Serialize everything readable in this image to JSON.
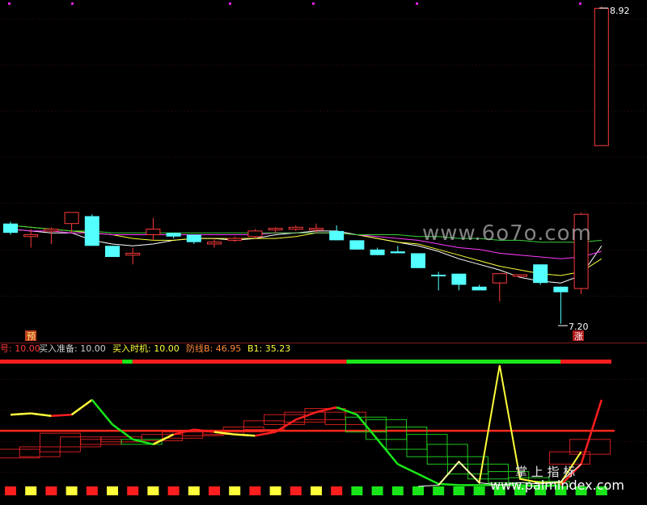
{
  "main_chart": {
    "high_label": "8.92",
    "low_label": "7.20",
    "marker_yu": "预",
    "marker_zhang": "涨"
  },
  "indicator_header": {
    "item0": "号: 10.00",
    "item1": "买入准备: 10.00",
    "item2": "买入时机: 10.00",
    "item3": "防线B: 46.95",
    "item4": "B1: 35.23"
  },
  "watermarks": {
    "top": "www.6o7o.com",
    "bottom_cn": "掌 上 指 标",
    "bottom_url": "www.palmindex.com"
  },
  "colors": {
    "up": "#ff3b3b",
    "down": "#54ffff",
    "ma_white": "#ffffff",
    "ma_yellow": "#ffff3a",
    "ma_magenta": "#ff3cff",
    "ma_green": "#3cd23c",
    "ind_red": "#ff1e1e",
    "ind_green": "#19e619"
  },
  "chart_data": [
    {
      "type": "candlestick",
      "title": "",
      "price_labels": {
        "high": 8.92,
        "low": 7.2
      },
      "candles": [
        {
          "o": 7.75,
          "h": 7.76,
          "l": 7.69,
          "c": 7.7,
          "up": false
        },
        {
          "o": 7.68,
          "h": 7.72,
          "l": 7.62,
          "c": 7.69,
          "up": true
        },
        {
          "o": 7.72,
          "h": 7.73,
          "l": 7.64,
          "c": 7.71,
          "up": true
        },
        {
          "o": 7.75,
          "h": 7.81,
          "l": 7.7,
          "c": 7.81,
          "up": true
        },
        {
          "o": 7.79,
          "h": 7.8,
          "l": 7.63,
          "c": 7.63,
          "up": false
        },
        {
          "o": 7.63,
          "h": 7.63,
          "l": 7.57,
          "c": 7.57,
          "up": false
        },
        {
          "o": 7.59,
          "h": 7.62,
          "l": 7.53,
          "c": 7.58,
          "up": true
        },
        {
          "o": 7.69,
          "h": 7.78,
          "l": 7.66,
          "c": 7.72,
          "up": true
        },
        {
          "o": 7.7,
          "h": 7.7,
          "l": 7.67,
          "c": 7.68,
          "up": false
        },
        {
          "o": 7.69,
          "h": 7.69,
          "l": 7.64,
          "c": 7.65,
          "up": false
        },
        {
          "o": 7.65,
          "h": 7.67,
          "l": 7.62,
          "c": 7.64,
          "up": true
        },
        {
          "o": 7.66,
          "h": 7.68,
          "l": 7.65,
          "c": 7.67,
          "up": true
        },
        {
          "o": 7.68,
          "h": 7.72,
          "l": 7.67,
          "c": 7.71,
          "up": true
        },
        {
          "o": 7.72,
          "h": 7.73,
          "l": 7.7,
          "c": 7.72,
          "up": true
        },
        {
          "o": 7.72,
          "h": 7.74,
          "l": 7.71,
          "c": 7.73,
          "up": true
        },
        {
          "o": 7.72,
          "h": 7.75,
          "l": 7.7,
          "c": 7.72,
          "up": true
        },
        {
          "o": 7.71,
          "h": 7.74,
          "l": 7.66,
          "c": 7.66,
          "up": false
        },
        {
          "o": 7.66,
          "h": 7.66,
          "l": 7.61,
          "c": 7.61,
          "up": false
        },
        {
          "o": 7.61,
          "h": 7.62,
          "l": 7.58,
          "c": 7.58,
          "up": false
        },
        {
          "o": 7.6,
          "h": 7.63,
          "l": 7.59,
          "c": 7.59,
          "up": false
        },
        {
          "o": 7.59,
          "h": 7.59,
          "l": 7.51,
          "c": 7.51,
          "up": false
        },
        {
          "o": 7.47,
          "h": 7.49,
          "l": 7.39,
          "c": 7.47,
          "up": false
        },
        {
          "o": 7.48,
          "h": 7.48,
          "l": 7.39,
          "c": 7.42,
          "up": false
        },
        {
          "o": 7.41,
          "h": 7.42,
          "l": 7.39,
          "c": 7.39,
          "up": false
        },
        {
          "o": 7.43,
          "h": 7.48,
          "l": 7.33,
          "c": 7.48,
          "up": true
        },
        {
          "o": 7.47,
          "h": 7.47,
          "l": 7.46,
          "c": 7.47,
          "up": true
        },
        {
          "o": 7.53,
          "h": 7.53,
          "l": 7.42,
          "c": 7.43,
          "up": false
        },
        {
          "o": 7.41,
          "h": 7.41,
          "l": 7.21,
          "c": 7.38,
          "up": false
        },
        {
          "o": 7.4,
          "h": 7.81,
          "l": 7.37,
          "c": 7.8,
          "up": true
        },
        {
          "o": 8.17,
          "h": 8.92,
          "l": 8.17,
          "c": 8.91,
          "up": true
        }
      ],
      "moving_averages": [
        {
          "color": "white",
          "values": [
            7.72,
            7.71,
            7.7,
            7.7,
            7.66,
            7.64,
            7.63,
            7.64,
            7.66,
            7.67,
            7.67,
            7.66,
            7.67,
            7.69,
            7.7,
            7.71,
            7.71,
            7.69,
            7.67,
            7.65,
            7.63,
            7.6,
            7.56,
            7.53,
            7.5,
            7.46,
            7.44,
            7.43,
            7.47,
            7.63
          ]
        },
        {
          "color": "yellow",
          "values": [
            7.74,
            7.73,
            7.72,
            7.71,
            7.7,
            7.69,
            7.67,
            7.66,
            7.66,
            7.67,
            7.67,
            7.67,
            7.67,
            7.67,
            7.68,
            7.7,
            7.7,
            7.69,
            7.67,
            7.65,
            7.64,
            7.61,
            7.58,
            7.55,
            7.52,
            7.5,
            7.48,
            7.47,
            7.49,
            7.56
          ]
        },
        {
          "color": "magenta",
          "values": [
            7.72,
            7.71,
            7.71,
            7.7,
            7.7,
            7.69,
            7.69,
            7.69,
            7.69,
            7.69,
            7.69,
            7.69,
            7.69,
            7.7,
            7.7,
            7.7,
            7.7,
            7.69,
            7.68,
            7.67,
            7.66,
            7.64,
            7.62,
            7.61,
            7.59,
            7.58,
            7.57,
            7.56,
            7.57,
            7.6
          ]
        },
        {
          "color": "green",
          "values": [
            7.74,
            7.73,
            7.72,
            7.71,
            7.71,
            7.7,
            7.7,
            7.7,
            7.7,
            7.7,
            7.7,
            7.7,
            7.7,
            7.7,
            7.7,
            7.7,
            7.7,
            7.69,
            7.69,
            7.69,
            7.68,
            7.68,
            7.67,
            7.67,
            7.66,
            7.66,
            7.65,
            7.65,
            7.65,
            7.66
          ]
        }
      ]
    },
    {
      "type": "line",
      "title": "",
      "ylim": [
        0,
        100
      ],
      "reference_line": 46.95,
      "signal_bar_top": [
        {
          "from": 0,
          "to": 6,
          "color": "red"
        },
        {
          "from": 6,
          "to": 6.5,
          "color": "green"
        },
        {
          "from": 6.5,
          "to": 17,
          "color": "red"
        },
        {
          "from": 17,
          "to": 27.5,
          "color": "green"
        },
        {
          "from": 27.5,
          "to": 30,
          "color": "red"
        }
      ],
      "signal_bar_bottom": [
        "red",
        "yellow",
        "red",
        "yellow",
        "red",
        "yellow",
        "red",
        "yellow",
        "red",
        "yellow",
        "red",
        "yellow",
        "red",
        "yellow",
        "red",
        "yellow",
        "red",
        "green",
        "green",
        "green",
        "green",
        "green",
        "green",
        "green",
        "green",
        "green",
        "green",
        "green",
        "green",
        "green"
      ],
      "series": [
        {
          "values": [
            60,
            61,
            59,
            60,
            72,
            52,
            40,
            36,
            44,
            48,
            46,
            44,
            43,
            46,
            56,
            62,
            66,
            60,
            40,
            20,
            12,
            4,
            3,
            3,
            3,
            3,
            2,
            3,
            20,
            72
          ],
          "colors": [
            "red",
            "yellow",
            "yellow",
            "red",
            "yellow",
            "green",
            "green",
            "green",
            "yellow",
            "red",
            "red",
            "yellow",
            "yellow",
            "red",
            "red",
            "red",
            "red",
            "green",
            "green",
            "green",
            "green",
            "green",
            "green",
            "green",
            "green",
            "green",
            "green",
            "green",
            "red",
            "red"
          ]
        },
        {
          "values": [
            null,
            null,
            null,
            null,
            null,
            null,
            null,
            null,
            null,
            null,
            null,
            null,
            null,
            null,
            null,
            null,
            null,
            null,
            null,
            null,
            null,
            3,
            22,
            5,
            100,
            8,
            5,
            5,
            30,
            null
          ],
          "color": "yellow"
        },
        {
          "values": [
            null,
            null,
            null,
            null,
            null,
            null,
            null,
            null,
            null,
            null,
            null,
            null,
            null,
            null,
            null,
            null,
            null,
            null,
            null,
            null,
            2,
            3,
            22,
            5,
            3,
            5,
            4,
            6,
            20,
            null
          ],
          "color": "white"
        }
      ],
      "boxes": [
        {
          "c": 0.5,
          "lo": 25,
          "hi": 32,
          "up": true
        },
        {
          "c": 1.5,
          "lo": 26,
          "hi": 34,
          "up": true
        },
        {
          "c": 2.5,
          "lo": 30,
          "hi": 45,
          "up": true
        },
        {
          "c": 3.5,
          "lo": 34,
          "hi": 42,
          "up": true
        },
        {
          "c": 4.5,
          "lo": 36,
          "hi": 40,
          "up": true
        },
        {
          "c": 5.5,
          "lo": 38,
          "hi": 42,
          "up": true
        },
        {
          "c": 6.5,
          "lo": 36,
          "hi": 40,
          "up": false
        },
        {
          "c": 7.5,
          "lo": 39,
          "hi": 44,
          "up": true
        },
        {
          "c": 8.5,
          "lo": 41,
          "hi": 46,
          "up": true
        },
        {
          "c": 9.5,
          "lo": 43,
          "hi": 47,
          "up": true
        },
        {
          "c": 10.5,
          "lo": 44,
          "hi": 46,
          "up": true
        },
        {
          "c": 11.5,
          "lo": 46,
          "hi": 50,
          "up": true
        },
        {
          "c": 12.5,
          "lo": 48,
          "hi": 55,
          "up": true
        },
        {
          "c": 13.5,
          "lo": 52,
          "hi": 60,
          "up": true
        },
        {
          "c": 14.5,
          "lo": 54,
          "hi": 62,
          "up": true
        },
        {
          "c": 15.5,
          "lo": 56,
          "hi": 65,
          "up": true
        },
        {
          "c": 16.5,
          "lo": 52,
          "hi": 62,
          "up": true
        },
        {
          "c": 17.5,
          "lo": 46,
          "hi": 58,
          "up": false
        },
        {
          "c": 18.5,
          "lo": 40,
          "hi": 56,
          "up": false
        },
        {
          "c": 19.5,
          "lo": 32,
          "hi": 50,
          "up": false
        },
        {
          "c": 20.5,
          "lo": 26,
          "hi": 44,
          "up": false
        },
        {
          "c": 21.5,
          "lo": 20,
          "hi": 36,
          "up": false
        },
        {
          "c": 22.5,
          "lo": 12,
          "hi": 26,
          "up": false
        },
        {
          "c": 23.5,
          "lo": 8,
          "hi": 20,
          "up": false
        },
        {
          "c": 24.5,
          "lo": 5,
          "hi": 14,
          "up": false
        },
        {
          "c": 25.5,
          "lo": 3,
          "hi": 9,
          "up": false
        },
        {
          "c": 26.5,
          "lo": 2,
          "hi": 6,
          "up": false
        },
        {
          "c": 27.5,
          "lo": 20,
          "hi": 30,
          "up": true
        },
        {
          "c": 28.5,
          "lo": 28,
          "hi": 40,
          "up": true
        }
      ]
    }
  ]
}
